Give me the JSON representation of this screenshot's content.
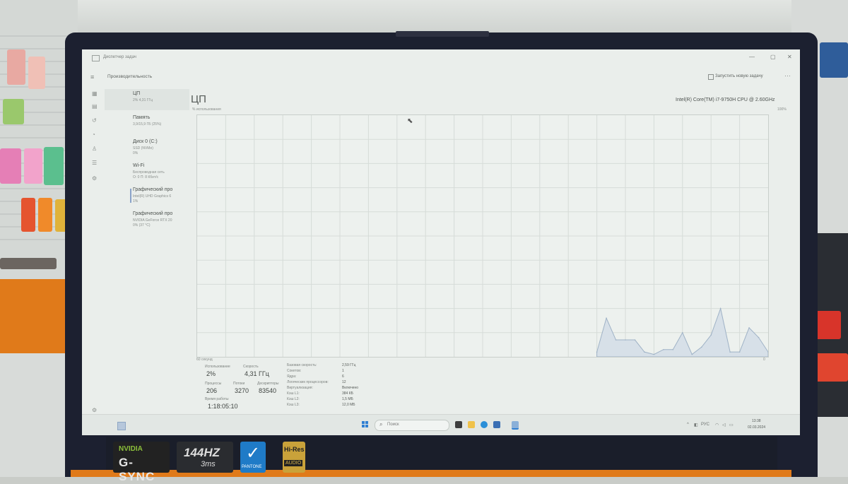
{
  "window": {
    "title": "Диспетчер задач"
  },
  "toolbar": {
    "heading": "Производительность",
    "run_task": "Запустить новую задачу",
    "more": "···"
  },
  "sidebar": {
    "items": [
      {
        "name": "ЦП",
        "detail": "2% 4,31 ГГц",
        "extra": ""
      },
      {
        "name": "Память",
        "detail": "3,9/15,9 ГБ (25%)",
        "extra": ""
      },
      {
        "name": "Диск 0 (C:)",
        "detail": "SSD (NVMe)",
        "extra": "0%"
      },
      {
        "name": "Wi-Fi",
        "detail": "Беспроводная сеть",
        "extra": "О: 0 П: 8 Кбит/с"
      },
      {
        "name": "Графический про",
        "detail": "Intel(R) UHD Graphics 6",
        "extra": "1%"
      },
      {
        "name": "Графический про",
        "detail": "NVIDIA GeForce RTX 20",
        "extra": "0% (37 °C)"
      }
    ]
  },
  "cpu": {
    "title": "ЦП",
    "subtitle": "% использования",
    "model": "Intel(R) Core(TM) i7-9750H CPU @ 2.60GHz",
    "max_pct": "100%",
    "axis_label": "60 секунд",
    "zero": "0"
  },
  "chart_data": {
    "type": "area",
    "title": "",
    "xlabel": "60 секунд",
    "ylabel": "% использования",
    "ylim": [
      0,
      100
    ],
    "x": [
      0,
      1,
      2,
      3,
      4,
      5,
      6,
      7,
      8,
      9,
      10,
      11,
      12,
      13,
      14,
      15,
      16,
      17,
      18,
      19,
      20,
      21,
      22,
      23,
      24,
      25,
      26,
      27,
      28,
      29,
      30,
      31,
      32,
      33,
      34,
      35,
      36,
      37,
      38,
      39,
      40,
      41,
      42,
      43,
      44,
      45,
      46,
      47,
      48,
      49,
      50,
      51,
      52,
      53,
      54,
      55,
      56,
      57,
      58,
      59,
      60
    ],
    "series": [
      {
        "values": [
          0,
          0,
          0,
          0,
          0,
          0,
          0,
          0,
          0,
          0,
          0,
          0,
          0,
          0,
          0,
          0,
          0,
          0,
          0,
          0,
          0,
          0,
          0,
          0,
          0,
          0,
          0,
          0,
          0,
          0,
          0,
          0,
          0,
          0,
          0,
          0,
          0,
          0,
          0,
          0,
          0,
          0,
          0,
          0,
          0,
          0,
          0,
          0,
          0,
          0,
          0,
          0,
          0,
          0,
          0,
          0,
          0,
          0,
          0,
          0,
          0
        ]
      },
      {
        "values": [
          2,
          16,
          7,
          7,
          7,
          2,
          1,
          3,
          3,
          10,
          1,
          4,
          9,
          20,
          2,
          2,
          12,
          8,
          2
        ]
      }
    ],
    "grid": true
  },
  "stats": {
    "util_label": "Использование",
    "util_value": "2%",
    "speed_label": "Скорость",
    "speed_value": "4,31 ГГц",
    "proc_label": "Процессы",
    "proc_value": "206",
    "threads_label": "Потоки",
    "threads_value": "3270",
    "handles_label": "Дескрипторы",
    "handles_value": "83540",
    "uptime_label": "Время работы",
    "uptime_value": "1:18:05:10",
    "details": [
      {
        "k": "Базовая скорость:",
        "v": "2,59 ГГц"
      },
      {
        "k": "Сокетов:",
        "v": "1"
      },
      {
        "k": "Ядра:",
        "v": "6"
      },
      {
        "k": "Логических процессоров:",
        "v": "12"
      },
      {
        "k": "Виртуализация:",
        "v": "Включено"
      },
      {
        "k": "Кэш L1:",
        "v": "384 КБ"
      },
      {
        "k": "Кэш L2:",
        "v": "1,5 МБ"
      },
      {
        "k": "Кэш L3:",
        "v": "12,0 МБ"
      }
    ]
  },
  "taskbar": {
    "search_placeholder": "Поиск",
    "lang": "РУС",
    "time": "13:38",
    "date": "02.03.2024"
  },
  "stickers": {
    "nvidia_brand": "NVIDIA",
    "nvidia_name": "G-SYNC",
    "refresh": "144HZ",
    "response": "3ms",
    "pantone": "PANTONE",
    "hires1": "Hi-Res",
    "hires2": "AUDIO"
  }
}
